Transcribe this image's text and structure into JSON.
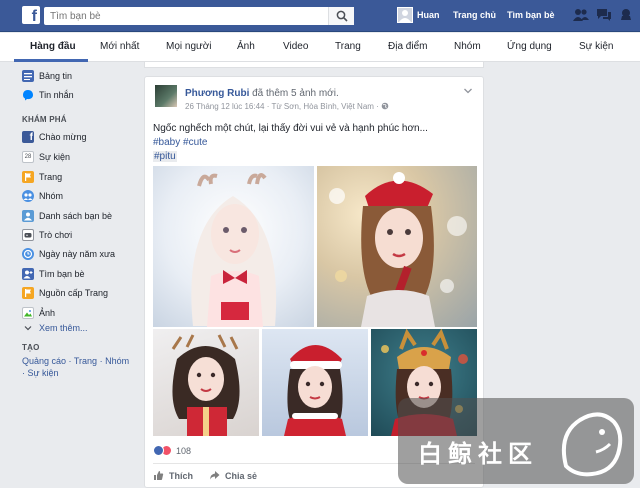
{
  "topbar": {
    "logo": "f",
    "search_placeholder": "Tìm bạn bè",
    "user_name": "Huan",
    "home_link": "Trang chủ",
    "find_friends_link": "Tìm bạn bè",
    "icons": [
      "friend-requests-icon",
      "messages-icon",
      "notifications-icon"
    ],
    "color": "#3b5998"
  },
  "nav": {
    "tabs": [
      "Hàng đầu",
      "Mới nhất",
      "Mọi người",
      "Ảnh",
      "Video",
      "Trang",
      "Địa điểm",
      "Nhóm",
      "Ứng dụng",
      "Sự kiện"
    ],
    "active_index": 0
  },
  "sidebar": {
    "top_items": [
      {
        "label": "Bảng tin",
        "icon": "news-feed-icon"
      },
      {
        "label": "Tin nhắn",
        "icon": "messenger-icon"
      }
    ],
    "explore_header": "KHÁM PHÁ",
    "explore_items": [
      {
        "label": "Chào mừng",
        "icon": "facebook-icon"
      },
      {
        "label": "Sự kiện",
        "icon": "calendar-icon"
      },
      {
        "label": "Trang",
        "icon": "flag-icon"
      },
      {
        "label": "Nhóm",
        "icon": "groups-icon"
      },
      {
        "label": "Danh sách bạn bè",
        "icon": "friend-list-icon"
      },
      {
        "label": "Trò chơi",
        "icon": "games-icon"
      },
      {
        "label": "Ngày này năm xưa",
        "icon": "on-this-day-icon"
      },
      {
        "label": "Tìm bạn bè",
        "icon": "find-friends-icon"
      },
      {
        "label": "Nguồn cấp Trang",
        "icon": "pages-feed-icon"
      },
      {
        "label": "Ảnh",
        "icon": "photos-icon"
      }
    ],
    "see_more": "Xem thêm...",
    "create_header": "TẠO",
    "create_links": [
      "Quảng cáo",
      "Trang",
      "Nhóm",
      "Sự kiện"
    ]
  },
  "post": {
    "author": "Phương Rubi",
    "action": "đã thêm 5 ảnh mới.",
    "meta": "26 Tháng 12 lúc 16:44 · Từ Sơn, Hòa Bình, Việt Nam ·",
    "privacy_icon": "public-globe-icon",
    "text": "Ngốc nghếch một chút, lại thấy đời vui vẻ và hạnh phúc hơn...",
    "tags_line1": [
      "#baby",
      "#cute"
    ],
    "tag_line2": "#pitu",
    "reaction_count": "108",
    "like_label": "Thích",
    "share_label": "Chia sẻ"
  },
  "watermark": {
    "text": "白鲸社区"
  }
}
